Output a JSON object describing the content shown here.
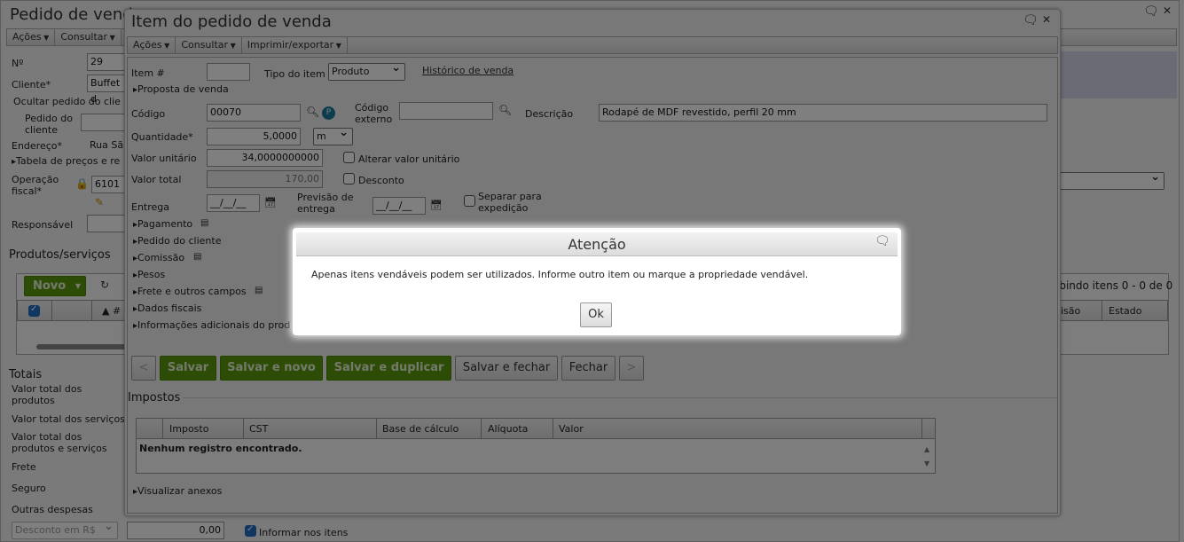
{
  "main_window": {
    "title": "Pedido de venda",
    "toolbar": [
      "Ações",
      "Consultar"
    ],
    "fields": {
      "numero_label": "Nº",
      "numero_value": "29",
      "cliente_label": "Cliente*",
      "cliente_value": "Buffet d",
      "ocultar_link": "Ocultar pedido do clie",
      "pedido_cliente_label": "Pedido do cliente",
      "endereco_label": "Endereço*",
      "endereco_value": "Rua Sã",
      "tabela_precos": "Tabela de preços e re",
      "operacao_label": "Operação fiscal*",
      "operacao_value": "6101",
      "responsavel_label": "Responsável"
    },
    "produtos": {
      "section_title": "Produtos/serviços",
      "new_button": "Novo",
      "sort_col": "#",
      "paging": "ibindo itens 0 - 0 de 0",
      "columns_right": [
        "isão",
        "Estado"
      ]
    },
    "totais": {
      "section_title": "Totais",
      "labels": [
        "Valor total dos produtos",
        "Valor total dos serviços",
        "Valor total dos produtos e serviços",
        "Frete",
        "Seguro",
        "Outras despesas"
      ],
      "desconto_select": "Desconto em R$",
      "desconto_value": "0,00",
      "informar_label": "Informar nos itens",
      "informar_checked": true
    }
  },
  "item_dialog": {
    "title": "Item do pedido de venda",
    "toolbar": [
      "Ações",
      "Consultar",
      "Imprimir/exportar"
    ],
    "item_label": "Item #",
    "item_value": "",
    "tipo_label": "Tipo do item",
    "tipo_value": "Produto",
    "historico_link": "Histórico de venda",
    "proposta": "Proposta de venda",
    "codigo_label": "Código",
    "codigo_value": "00070",
    "codigo_externo_label": "Código externo",
    "codigo_externo_value": "",
    "descricao_label": "Descrição",
    "descricao_value": "Rodapé de MDF revestido, perfil 20 mm",
    "quantidade_label": "Quantidade*",
    "quantidade_value": "5,0000",
    "unidade_value": "m",
    "valor_unit_label": "Valor unitário",
    "valor_unit_value": "34,0000000000",
    "alterar_label": "Alterar valor unitário",
    "valor_total_label": "Valor total",
    "valor_total_value": "170,00",
    "desconto_label": "Desconto",
    "entrega_label": "Entrega",
    "entrega_value": "__/__/__",
    "previsao_label": "Previsão de entrega",
    "previsao_value": "__/__/__",
    "separar_label": "Separar para expedição",
    "sections": [
      "Pagamento",
      "Pedido do cliente",
      "Comissão",
      "Pesos",
      "Frete e outros campos",
      "Dados fiscais",
      "Informações adicionais do prod"
    ],
    "buttons": {
      "prev": "<",
      "salvar": "Salvar",
      "salvar_novo": "Salvar e novo",
      "salvar_duplicar": "Salvar e duplicar",
      "salvar_fechar": "Salvar e fechar",
      "fechar": "Fechar",
      "next": ">"
    },
    "impostos": {
      "title": "Impostos",
      "columns": [
        "Imposto",
        "CST",
        "Base de cálculo",
        "Alíquota",
        "Valor"
      ],
      "empty": "Nenhum registro encontrado."
    },
    "anexos": "Visualizar anexos"
  },
  "alert": {
    "title": "Atenção",
    "message": "Apenas itens vendáveis podem ser utilizados. Informe outro item ou marque a propriedade vendável.",
    "ok": "Ok"
  }
}
